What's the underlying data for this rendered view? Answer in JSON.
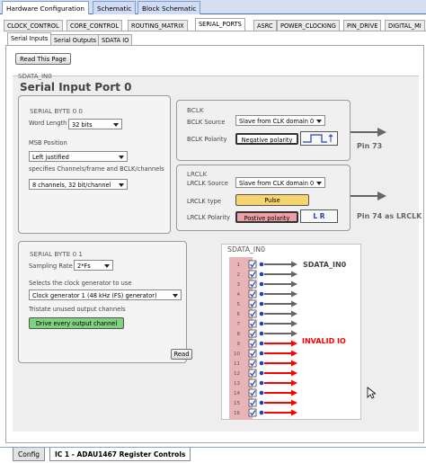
{
  "doc_tabs": [
    "Hardware Configuration",
    "Schematic",
    "Block Schematic"
  ],
  "reg_tabs": [
    "CLOCK_CONTROL",
    "CORE_CONTROL",
    "ROUTING_MATRIX",
    "SERIAL_PORTS",
    "ASRC",
    "POWER_CLOCKING",
    "PIN_DRIVE",
    "DIGITAL_MI"
  ],
  "sub_tabs": [
    "Serial Inputs",
    "Serial Outputs",
    "SDATA IO"
  ],
  "read_page_button": "Read This Page",
  "port": {
    "small_title": "SDATA_IN0",
    "title": "Serial Input Port 0"
  },
  "byte0": {
    "title": "SERIAL BYTE 0 0",
    "word_length_label": "Word Length",
    "word_length_value": "32 bits",
    "msb_label": "MSB Position",
    "msb_value": "Left justified",
    "spec_label": "specifies Channels/frame and BCLK/channels",
    "spec_value": "8 channels, 32 bit/channel"
  },
  "bclk": {
    "title": "BCLK",
    "source_label": "BCLK Source",
    "source_value": "Slave from CLK domain 0",
    "polarity_label": "BCLK Polarity",
    "polarity_value": "Negative polarity",
    "pin": "Pin 73"
  },
  "lrclk": {
    "title": "LRCLK",
    "source_label": "LRCLK Source",
    "source_value": "Slave from CLK domain 0",
    "type_label": "LRCLK type",
    "type_value": "Pulse",
    "polarity_label": "LRCLK Polarity",
    "polarity_value": "Postive polarity",
    "lr_glyph": "L R",
    "pin": "Pin 74 as LRCLK"
  },
  "byte1": {
    "title": "SERIAL BYTE 0 1",
    "rate_label": "Sampling Rate",
    "rate_value": "2*Fs",
    "clock_label": "Selects the clock generator to use",
    "clock_value": "Clock generator 1 (48 kHz (FS) generator)",
    "tristate_label": "Tristate unused output channels",
    "drive_button": "Drive every output channel",
    "read_button": "Read"
  },
  "channels": {
    "title": "SDATA_IN0",
    "valid_label": "SDATA_IN0",
    "invalid_label": "INVALID IO",
    "numbers": [
      "1",
      "2",
      "3",
      "4",
      "5",
      "6",
      "7",
      "8",
      "9",
      "10",
      "11",
      "12",
      "13",
      "14",
      "15",
      "16"
    ],
    "valid_count": 8,
    "colors": {
      "valid": "#666666",
      "invalid": "#ff0000",
      "strip": "#e8b4b8",
      "dot": "#1f3fbf"
    }
  },
  "bottom_tabs": [
    "Config",
    "IC 1 - ADAU1467 Register Controls"
  ]
}
